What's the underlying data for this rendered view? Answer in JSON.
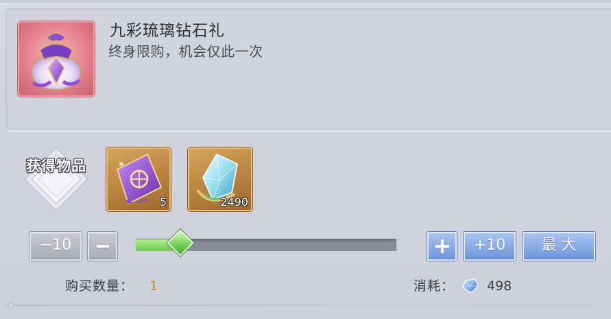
{
  "pack": {
    "title": "九彩琉璃钻石礼",
    "description": "终身限购，机会仅此一次",
    "icon": "purple-gift-bag-icon"
  },
  "rewards": {
    "label": "获得物品",
    "items": [
      {
        "icon": "purple-scroll-icon",
        "count": "5"
      },
      {
        "icon": "diamond-crystal-icon",
        "count": "2490"
      }
    ]
  },
  "quantity_controls": {
    "minus_ten_label": "−10",
    "plus_ten_label": "+10",
    "max_label": "最 大",
    "slider_fraction": 0.17
  },
  "purchase": {
    "quantity_label": "购买数量：",
    "quantity_value": "1",
    "cost_label": "消耗：",
    "cost_icon": "blue-diamond-icon",
    "cost_value": "498"
  },
  "colors": {
    "slider_fill": "#69c94a",
    "button_blue": "#6f95dc",
    "button_grey": "#a9abb6",
    "quantity_value": "#b58a34"
  }
}
